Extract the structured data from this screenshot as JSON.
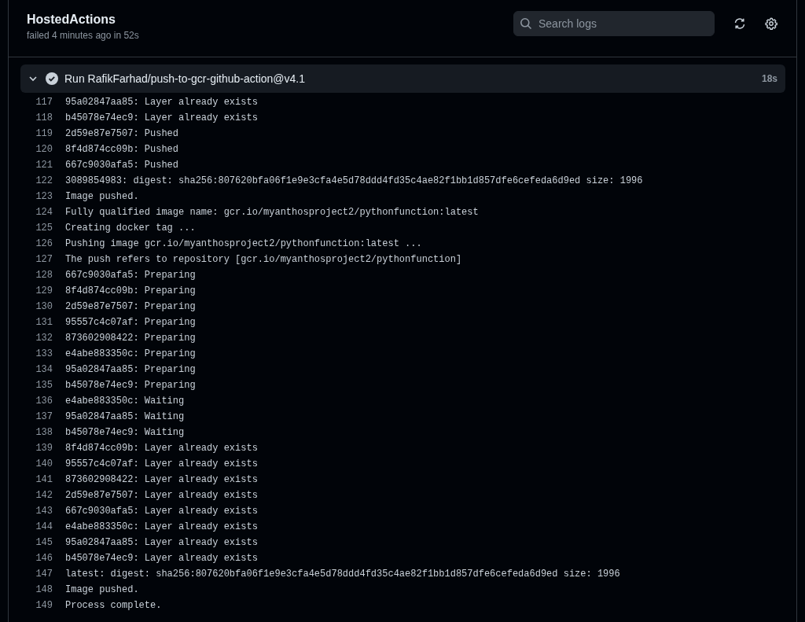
{
  "header": {
    "title": "HostedActions",
    "subtitle": "failed 4 minutes ago in 52s"
  },
  "search": {
    "placeholder": "Search logs"
  },
  "step": {
    "expanded": true,
    "succeeded": true,
    "title": "Run RafikFarhad/push-to-gcr-github-action@v4.1",
    "duration": "18s"
  },
  "log_lines": [
    {
      "number": "117",
      "text": "95a02847aa85: Layer already exists"
    },
    {
      "number": "118",
      "text": "b45078e74ec9: Layer already exists"
    },
    {
      "number": "119",
      "text": "2d59e87e7507: Pushed"
    },
    {
      "number": "120",
      "text": "8f4d874cc09b: Pushed"
    },
    {
      "number": "121",
      "text": "667c9030afa5: Pushed"
    },
    {
      "number": "122",
      "text": "3089854983: digest: sha256:807620bfa06f1e9e3cfa4e5d78ddd4fd35c4ae82f1bb1d857dfe6cefeda6d9ed size: 1996"
    },
    {
      "number": "123",
      "text": "Image pushed."
    },
    {
      "number": "124",
      "text": "Fully qualified image name: gcr.io/myanthosproject2/pythonfunction:latest"
    },
    {
      "number": "125",
      "text": "Creating docker tag ..."
    },
    {
      "number": "126",
      "text": "Pushing image gcr.io/myanthosproject2/pythonfunction:latest ..."
    },
    {
      "number": "127",
      "text": "The push refers to repository [gcr.io/myanthosproject2/pythonfunction]"
    },
    {
      "number": "128",
      "text": "667c9030afa5: Preparing"
    },
    {
      "number": "129",
      "text": "8f4d874cc09b: Preparing"
    },
    {
      "number": "130",
      "text": "2d59e87e7507: Preparing"
    },
    {
      "number": "131",
      "text": "95557c4c07af: Preparing"
    },
    {
      "number": "132",
      "text": "873602908422: Preparing"
    },
    {
      "number": "133",
      "text": "e4abe883350c: Preparing"
    },
    {
      "number": "134",
      "text": "95a02847aa85: Preparing"
    },
    {
      "number": "135",
      "text": "b45078e74ec9: Preparing"
    },
    {
      "number": "136",
      "text": "e4abe883350c: Waiting"
    },
    {
      "number": "137",
      "text": "95a02847aa85: Waiting"
    },
    {
      "number": "138",
      "text": "b45078e74ec9: Waiting"
    },
    {
      "number": "139",
      "text": "8f4d874cc09b: Layer already exists"
    },
    {
      "number": "140",
      "text": "95557c4c07af: Layer already exists"
    },
    {
      "number": "141",
      "text": "873602908422: Layer already exists"
    },
    {
      "number": "142",
      "text": "2d59e87e7507: Layer already exists"
    },
    {
      "number": "143",
      "text": "667c9030afa5: Layer already exists"
    },
    {
      "number": "144",
      "text": "e4abe883350c: Layer already exists"
    },
    {
      "number": "145",
      "text": "95a02847aa85: Layer already exists"
    },
    {
      "number": "146",
      "text": "b45078e74ec9: Layer already exists"
    },
    {
      "number": "147",
      "text": "latest: digest: sha256:807620bfa06f1e9e3cfa4e5d78ddd4fd35c4ae82f1bb1d857dfe6cefeda6d9ed size: 1996"
    },
    {
      "number": "148",
      "text": "Image pushed."
    },
    {
      "number": "149",
      "text": "Process complete."
    }
  ]
}
